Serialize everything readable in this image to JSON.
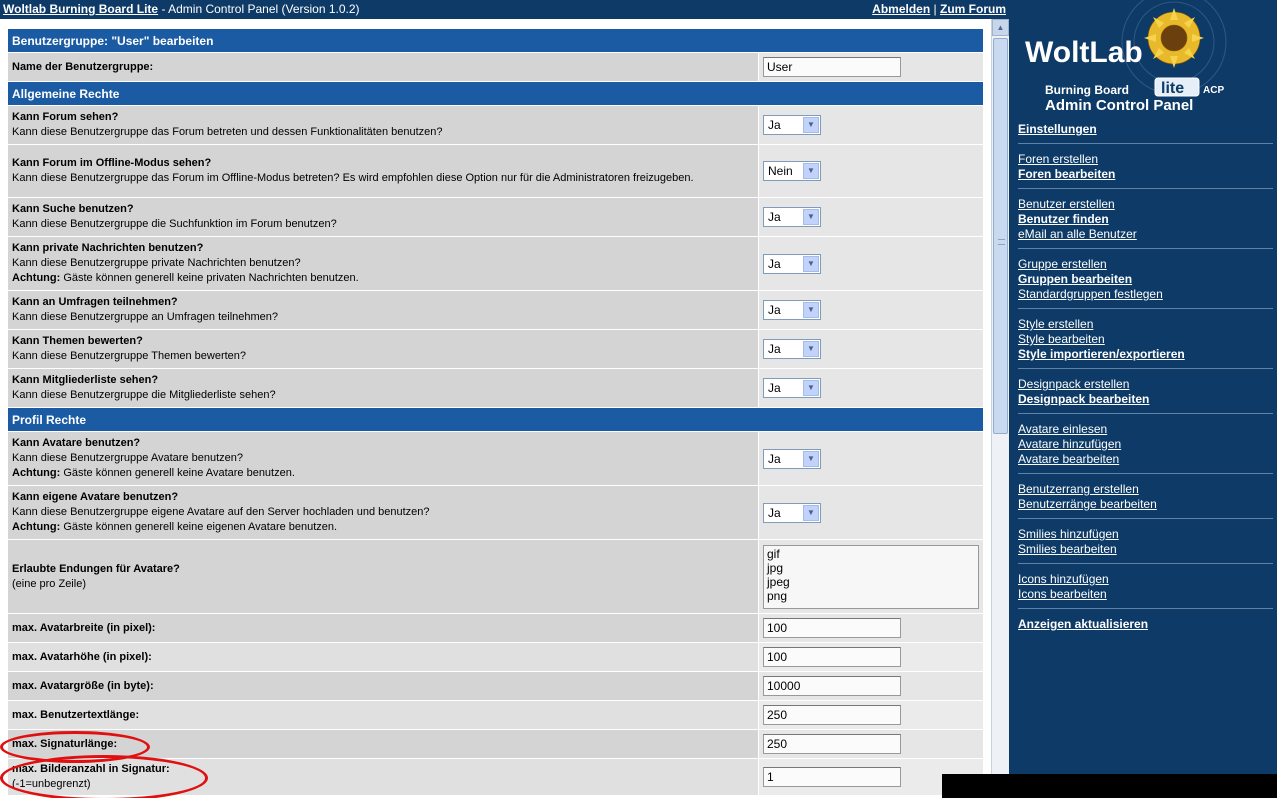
{
  "topbar": {
    "app_name": "Woltlab Burning Board Lite",
    "subtitle": " - Admin Control Panel (Version 1.0.2)",
    "logout": "Abmelden",
    "separator": "|",
    "to_forum": "Zum Forum"
  },
  "form": {
    "title": "Benutzergruppe: \"User\" bearbeiten",
    "group_name_label": "Name der Benutzergruppe:",
    "group_name_value": "User",
    "section_general": "Allgemeine Rechte",
    "section_profile": "Profil Rechte",
    "rows": [
      {
        "title": "Kann Forum sehen?",
        "desc": "Kann diese Benutzergruppe das Forum betreten und dessen Funktionalitäten benutzen?",
        "value": "Ja"
      },
      {
        "title": "Kann Forum im Offline-Modus sehen?",
        "desc": "Kann diese Benutzergruppe das Forum im Offline-Modus betreten? Es wird empfohlen diese Option nur für die Administratoren freizugeben.",
        "value": "Nein"
      },
      {
        "title": "Kann Suche benutzen?",
        "desc": "Kann diese Benutzergruppe die Suchfunktion im Forum benutzen?",
        "value": "Ja"
      },
      {
        "title": "Kann private Nachrichten benutzen?",
        "desc": "Kann diese Benutzergruppe private Nachrichten benutzen?",
        "note_label": "Achtung:",
        "note": " Gäste können generell keine privaten Nachrichten benutzen.",
        "value": "Ja"
      },
      {
        "title": "Kann an Umfragen teilnehmen?",
        "desc": "Kann diese Benutzergruppe an Umfragen teilnehmen?",
        "value": "Ja"
      },
      {
        "title": "Kann Themen bewerten?",
        "desc": "Kann diese Benutzergruppe Themen bewerten?",
        "value": "Ja"
      },
      {
        "title": "Kann Mitgliederliste sehen?",
        "desc": "Kann diese Benutzergruppe die Mitgliederliste sehen?",
        "value": "Ja"
      },
      {
        "title": "Kann Avatare benutzen?",
        "desc": "Kann diese Benutzergruppe Avatare benutzen?",
        "note_label": "Achtung:",
        "note": " Gäste können generell keine Avatare benutzen.",
        "value": "Ja"
      },
      {
        "title": "Kann eigene Avatare benutzen?",
        "desc": "Kann diese Benutzergruppe eigene Avatare auf den Server hochladen und benutzen?",
        "note_label": "Achtung:",
        "note": " Gäste können generell keine eigenen Avatare benutzen.",
        "value": "Ja"
      }
    ],
    "extensions": {
      "title": "Erlaubte Endungen für Avatare?",
      "desc": "(eine pro Zeile)",
      "values": [
        "gif",
        "jpg",
        "jpeg",
        "png"
      ]
    },
    "fields": [
      {
        "label": "max. Avatarbreite (in pixel):",
        "value": "100"
      },
      {
        "label": "max. Avatarhöhe (in pixel):",
        "value": "100"
      },
      {
        "label": "max. Avatargröße (in byte):",
        "value": "10000"
      },
      {
        "label": "max. Benutzertextlänge:",
        "value": "250"
      },
      {
        "label": "max. Signaturlänge:",
        "value": "250"
      },
      {
        "label": "max. Bilderanzahl in Signatur:",
        "desc": "(-1=unbegrenzt)",
        "value": "1"
      }
    ]
  },
  "sidebar": {
    "logo": {
      "brand": "WoltLab",
      "product": "Burning Board",
      "edition": "lite",
      "acp": "ACP",
      "panel": "Admin Control Panel"
    },
    "groups": [
      [
        {
          "label": "Einstellungen",
          "bold": true
        }
      ],
      [
        {
          "label": "Foren erstellen"
        },
        {
          "label": "Foren bearbeiten",
          "bold": true
        }
      ],
      [
        {
          "label": "Benutzer erstellen"
        },
        {
          "label": "Benutzer finden",
          "bold": true
        },
        {
          "label": "eMail an alle Benutzer"
        }
      ],
      [
        {
          "label": "Gruppe erstellen"
        },
        {
          "label": "Gruppen bearbeiten",
          "bold": true
        },
        {
          "label": "Standardgruppen festlegen"
        }
      ],
      [
        {
          "label": "Style erstellen"
        },
        {
          "label": "Style bearbeiten"
        },
        {
          "label": "Style importieren/exportieren",
          "bold": true
        }
      ],
      [
        {
          "label": "Designpack erstellen"
        },
        {
          "label": "Designpack bearbeiten",
          "bold": true
        }
      ],
      [
        {
          "label": "Avatare einlesen"
        },
        {
          "label": "Avatare hinzufügen"
        },
        {
          "label": "Avatare bearbeiten"
        }
      ],
      [
        {
          "label": "Benutzerrang erstellen"
        },
        {
          "label": "Benutzerränge bearbeiten"
        }
      ],
      [
        {
          "label": "Smilies hinzufügen"
        },
        {
          "label": "Smilies bearbeiten"
        }
      ],
      [
        {
          "label": "Icons hinzufügen"
        },
        {
          "label": "Icons bearbeiten"
        }
      ],
      [
        {
          "label": "Anzeigen aktualisieren",
          "bold": true
        }
      ]
    ]
  },
  "colors": {
    "header_blue": "#1a5ba3",
    "background_navy": "#0d3a66",
    "annotation_red": "#e01010"
  }
}
